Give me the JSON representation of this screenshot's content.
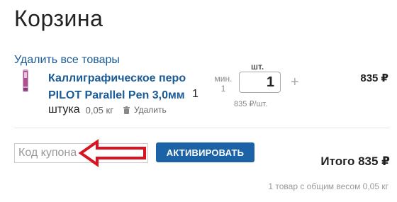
{
  "header": {
    "title": "Корзина"
  },
  "cart": {
    "remove_all_label": "Удалить все товары",
    "item": {
      "name": "Каллиграфическое перо PILOT Parallel Pen 3,0мм",
      "qty_count": "1",
      "qty_unit": "штука",
      "weight": "0,05 кг",
      "delete_label": "Удалить",
      "min_label": "мин.",
      "min_value": "1",
      "unit_label": "шт.",
      "quantity": "1",
      "plus_symbol": "+",
      "unit_price": "835 ₽/шт.",
      "line_price": "835 ₽"
    }
  },
  "coupon": {
    "placeholder": "Код купона",
    "activate_label": "АКТИВИРОВАТЬ"
  },
  "summary": {
    "total": "Итого 835 ₽",
    "details": "1 товар с общим весом 0,05 кг"
  },
  "colors": {
    "link": "#1a5a96",
    "button": "#1b63a6",
    "arrow": "#d9131f"
  },
  "icons": {
    "delete": "trash-icon",
    "annotation": "red-arrow-icon"
  }
}
